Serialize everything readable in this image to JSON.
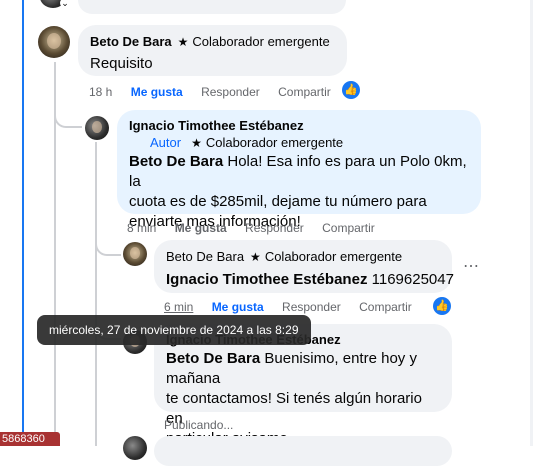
{
  "comments": [
    {
      "author": "Beto De Bara",
      "badge": "Colaborador emergente",
      "text": "Requisito",
      "time": "18 h",
      "actions": [
        "Me gusta",
        "Responder",
        "Compartir"
      ]
    },
    {
      "author": "Ignacio Timothee Estébanez",
      "author_tag": "Autor",
      "badge": "Colaborador emergente",
      "mention": "Beto De Bara",
      "text": "Hola! Esa info es para un Polo 0km, la cuota es de $285mil, dejame tu número para enviarte mas información!",
      "line1": "Hola! Esa info es para un Polo 0km, la",
      "line2": "cuota es de $285mil, dejame tu número para",
      "line3": "enviarte mas información!",
      "time": "8 min",
      "actions": [
        "Me gusta",
        "Responder",
        "Compartir"
      ]
    },
    {
      "author": "Beto De Bara",
      "badge": "Colaborador emergente",
      "mention": "Ignacio Timothee Estébanez",
      "text": "1169625047",
      "time": "6 min",
      "actions": [
        "Me gusta",
        "Responder",
        "Compartir"
      ]
    },
    {
      "author": "Ignacio Timothee Estébanez",
      "mention": "Beto De Bara",
      "line1": "Buenisimo, entre hoy y mañana",
      "line2": "te contactamos! Si tenés algún horario en",
      "line3": "particular avisame",
      "status": "Publicando..."
    }
  ],
  "tooltip": "miércoles, 27 de noviembre de 2024 a las 8:29",
  "bottom_tag": "5868360",
  "icons": {
    "star": "star-icon",
    "like": "thumbs-up-icon",
    "more": "more-icon"
  },
  "colors": {
    "accent": "#0866ff",
    "bubble": "#f0f2f5",
    "bubble_own": "#e7f3ff"
  }
}
